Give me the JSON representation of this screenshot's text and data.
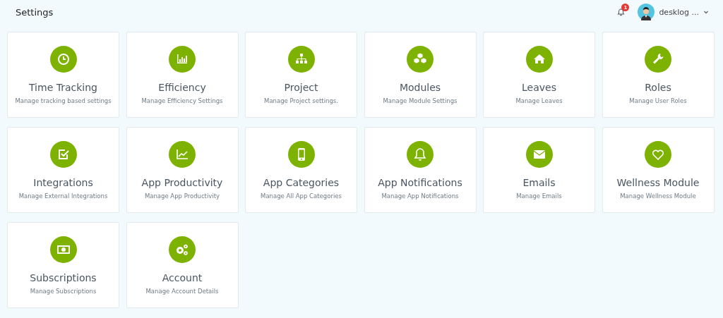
{
  "header": {
    "title": "Settings",
    "notifications": {
      "count": "1"
    },
    "user": {
      "name": "desklog ..."
    }
  },
  "cards": [
    {
      "title": "Time Tracking",
      "description": "Manage tracking based settings"
    },
    {
      "title": "Efficiency",
      "description": "Manage Efficiency Settings"
    },
    {
      "title": "Project",
      "description": "Manage Project settings."
    },
    {
      "title": "Modules",
      "description": "Manage Module Settings"
    },
    {
      "title": "Leaves",
      "description": "Manage Leaves"
    },
    {
      "title": "Roles",
      "description": "Manage User Roles"
    },
    {
      "title": "Integrations",
      "description": "Manage External Integrations"
    },
    {
      "title": "App Productivity",
      "description": "Manage App Productivity"
    },
    {
      "title": "App Categories",
      "description": "Manage All App Categories"
    },
    {
      "title": "App Notifications",
      "description": "Manage App Notifications"
    },
    {
      "title": "Emails",
      "description": "Manage Emails"
    },
    {
      "title": "Wellness Module",
      "description": "Manage Wellness Module"
    },
    {
      "title": "Subscriptions",
      "description": "Manage Subscriptions"
    },
    {
      "title": "Account",
      "description": "Manage Account Details"
    }
  ]
}
